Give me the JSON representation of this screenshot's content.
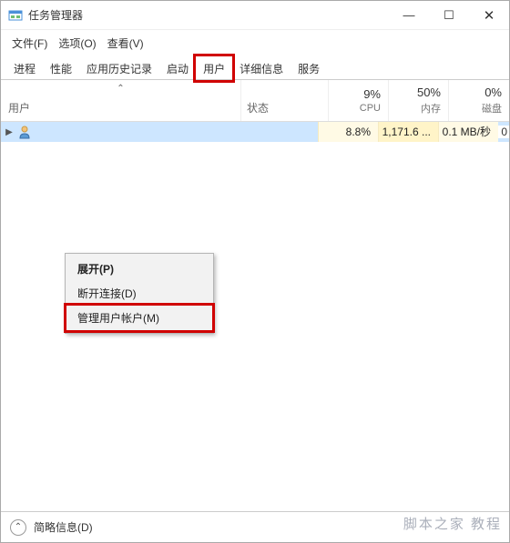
{
  "window": {
    "title": "任务管理器",
    "min_tooltip": "最小化",
    "max_tooltip": "最大化",
    "close_tooltip": "关闭"
  },
  "menu": {
    "file": "文件(F)",
    "options": "选项(O)",
    "view": "查看(V)"
  },
  "tabs": {
    "processes": "进程",
    "performance": "性能",
    "app_history": "应用历史记录",
    "startup": "启动",
    "users": "用户",
    "details": "详细信息",
    "services": "服务"
  },
  "columns": {
    "user": "用户",
    "status": "状态",
    "cpu_pct": "9%",
    "cpu_label": "CPU",
    "mem_pct": "50%",
    "mem_label": "内存",
    "disk_pct": "0%",
    "disk_label": "磁盘"
  },
  "rows": [
    {
      "cpu": "8.8%",
      "mem": "1,171.6 ...",
      "disk": "0.1 MB/秒",
      "extra": "0"
    }
  ],
  "context_menu": {
    "expand": "展开(P)",
    "disconnect": "断开连接(D)",
    "manage": "管理用户帐户(M)"
  },
  "footer": {
    "brief": "简略信息(D)"
  },
  "watermark": "脚本之家 教程"
}
